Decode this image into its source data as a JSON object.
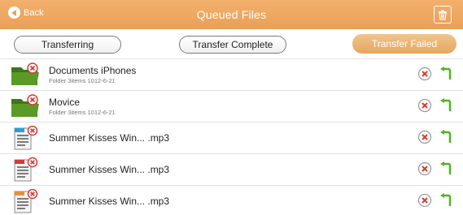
{
  "header": {
    "back_label": "Back",
    "title": "Queued Files",
    "icons": {
      "back": "back-arrow-icon",
      "trash": "trash-icon"
    }
  },
  "tabs": [
    {
      "label": "Transferring",
      "state": "inactive"
    },
    {
      "label": "Transfer Complete",
      "state": "inactive"
    },
    {
      "label": "Transfer Failed",
      "state": "active"
    }
  ],
  "files": [
    {
      "name": "Documents iPhones",
      "meta": "Folder  3items  1012-6-21",
      "icon": "folder-icon"
    },
    {
      "name": "Movice",
      "meta": "Folder  3items  1012-6-21",
      "icon": "folder-icon"
    },
    {
      "name": "Summer Kisses Win...  .mp3",
      "meta": "",
      "icon": "document-blue-icon"
    },
    {
      "name": "Summer Kisses Win...  .mp3",
      "meta": "",
      "icon": "document-red-icon"
    },
    {
      "name": "Summer Kisses Win...  .mp3",
      "meta": "",
      "icon": "document-orange-icon"
    }
  ],
  "colors": {
    "header": "#e9a057",
    "active_tab": "#e5a65f",
    "folder": "#4f8a1f",
    "error_badge": "#d63a3a",
    "retry": "#4fb51f"
  }
}
